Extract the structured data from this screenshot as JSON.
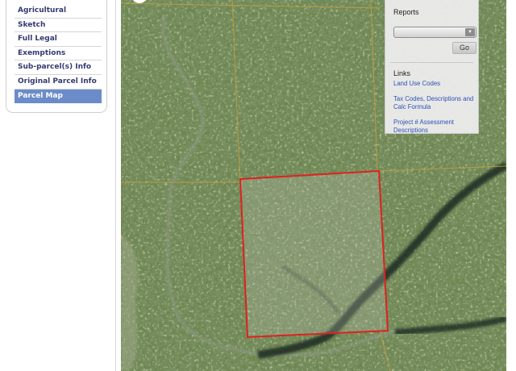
{
  "sidebar": {
    "items": [
      {
        "label": "Agricultural",
        "active": false
      },
      {
        "label": "Sketch",
        "active": false
      },
      {
        "label": "Full Legal",
        "active": false
      },
      {
        "label": "Exemptions",
        "active": false
      },
      {
        "label": "Sub-parcel(s) Info",
        "active": false
      },
      {
        "label": "Original Parcel Info",
        "active": false
      },
      {
        "label": "Parcel Map",
        "active": true
      }
    ]
  },
  "reports": {
    "title": "Reports",
    "select_value": "",
    "go_label": "Go"
  },
  "links": {
    "title": "Links",
    "items": [
      {
        "label": "Land Use Codes"
      },
      {
        "label": "Tax Codes, Descriptions and Calc Formula"
      },
      {
        "label": "Project # Assessment Descriptions"
      }
    ]
  },
  "colors": {
    "accent": "#6b8cc9",
    "nav_text": "#333a70",
    "link": "#2e4fb8",
    "parcel_outline": "#e02020",
    "parcel_lines": "#c8a040"
  },
  "map": {
    "type": "aerial parcel map",
    "selected_parcel": "highlighted"
  }
}
